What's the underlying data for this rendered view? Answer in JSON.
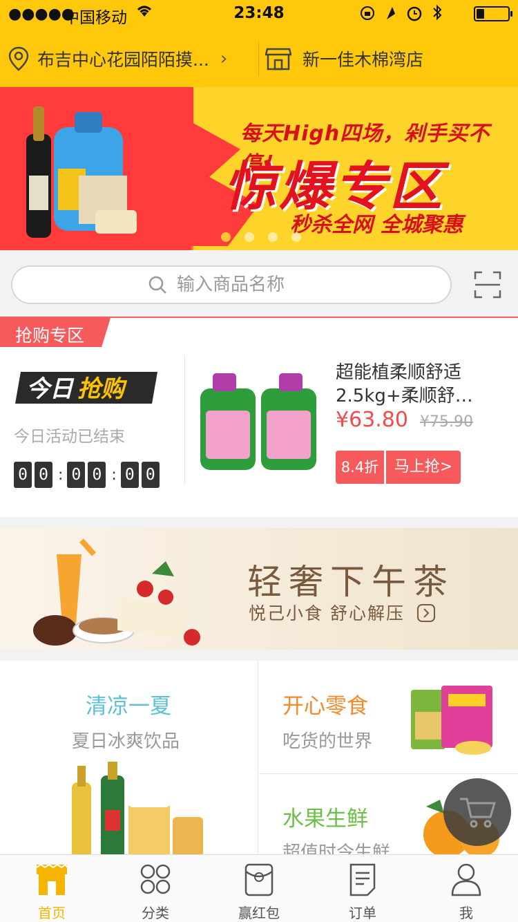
{
  "status_bar": {
    "signal": "●●●●●",
    "carrier": "中国移动",
    "time": "23:48",
    "battery_level": 0.25
  },
  "header": {
    "location_label": "布吉中心花园陌陌摸...",
    "store_name": "新一佳木棉湾店"
  },
  "banner": {
    "headline": "每天High四场，剁手买不停！",
    "title": "惊爆专区",
    "subtitle": "秒杀全网 全城聚惠",
    "slide_count": 4,
    "active_slide": 1
  },
  "search": {
    "placeholder": "输入商品名称"
  },
  "flash_sale": {
    "tag": "抢购专区",
    "logo_text_1": "今日",
    "logo_text_2": "抢购",
    "status": "今日活动已结束",
    "countdown": [
      "0",
      "0",
      "0",
      "0",
      "0",
      "0"
    ],
    "product": {
      "name_line1": "超能植柔顺舒适",
      "name_line2": "2.5kg+柔顺舒…",
      "price": "¥63.80",
      "original_price": "¥75.90",
      "discount": "8.4折",
      "buy_label": "马上抢>"
    }
  },
  "tea_banner": {
    "title": "轻奢下午茶",
    "subtitle": "悦己小食 舒心解压"
  },
  "categories": [
    {
      "title": "清凉一夏",
      "subtitle": "夏日冰爽饮品",
      "color": "#5bbfd8"
    },
    {
      "title": "开心零食",
      "subtitle": "吃货的世界",
      "color": "#f5892a"
    },
    {
      "title": "水果生鲜",
      "subtitle": "超值时令生鲜",
      "color": "#6cc04a"
    }
  ],
  "tabbar": {
    "items": [
      {
        "label": "首页",
        "icon": "home-icon",
        "active": true
      },
      {
        "label": "分类",
        "icon": "category-icon",
        "active": false
      },
      {
        "label": "赢红包",
        "icon": "red-envelope-icon",
        "active": false
      },
      {
        "label": "订单",
        "icon": "order-icon",
        "active": false
      },
      {
        "label": "我",
        "icon": "user-icon",
        "active": false
      }
    ]
  },
  "colors": {
    "brand_yellow": "#ffc80a",
    "accent_red": "#f65a5a",
    "active_tab": "#f5b400"
  }
}
